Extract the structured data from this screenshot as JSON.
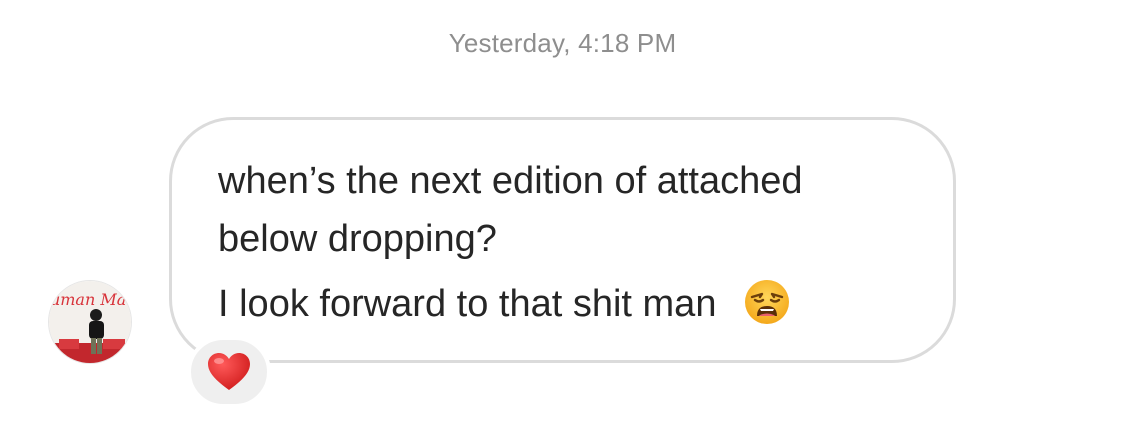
{
  "conversation": {
    "timestamp": "Yesterday, 4:18 PM",
    "message": {
      "lines": [
        "when’s the next edition of attached",
        "below dropping?",
        "I look forward to that shit man"
      ],
      "emoji": "weary-face-emoji"
    },
    "reaction": {
      "emoji": "red-heart-emoji"
    },
    "avatar": {
      "text": "Human Made"
    }
  },
  "colors": {
    "timestamp": "#8e8e8e",
    "bubble_border": "#dbdbdb",
    "message_text": "#262626",
    "reaction_bg": "#efefef",
    "heart": "#e02020"
  }
}
